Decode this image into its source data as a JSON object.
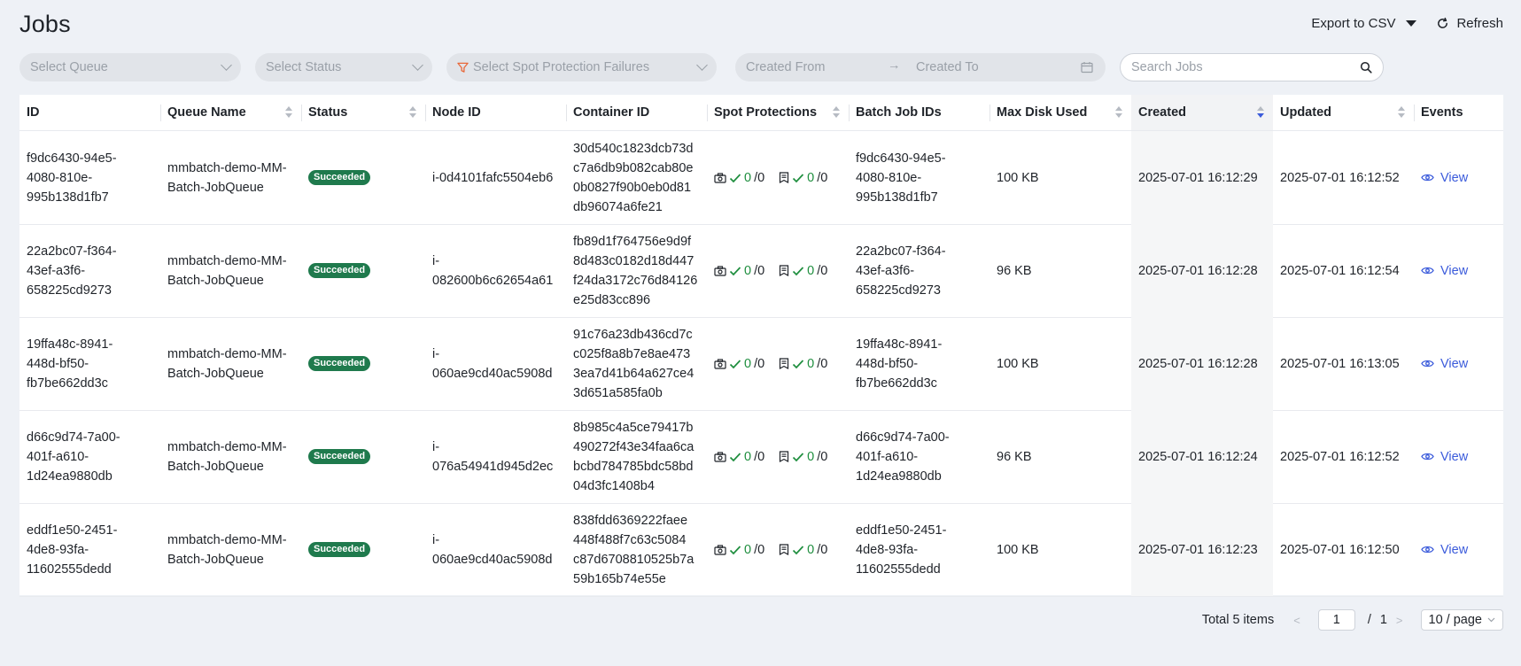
{
  "header": {
    "title": "Jobs",
    "export_label": "Export to CSV",
    "refresh_label": "Refresh"
  },
  "filters": {
    "queue_placeholder": "Select Queue",
    "status_placeholder": "Select Status",
    "spot_placeholder": "Select Spot Protection Failures",
    "created_from_placeholder": "Created From",
    "created_to_placeholder": "Created To",
    "search_placeholder": "Search Jobs"
  },
  "columns": [
    "ID",
    "Queue Name",
    "Status",
    "Node ID",
    "Container ID",
    "Spot Protections",
    "Batch Job IDs",
    "Max Disk Used",
    "Created",
    "Updated",
    "Events"
  ],
  "rows": [
    {
      "id": "f9dc6430-94e5-\n4080-810e-\n995b138d1fb7",
      "queue": "mmbatch-demo-MM-\nBatch-JobQueue",
      "status": "Succeeded",
      "node": "i-0d4101fafc5504eb6",
      "container": "30d540c1823dcb73d\nc7a6db9b082cab80e\n0b0827f90b0eb0d81\ndb96074a6fe21",
      "spot_a_ok": "0",
      "spot_a_total": "/0",
      "spot_b_ok": "0",
      "spot_b_total": "/0",
      "batch": "f9dc6430-94e5-\n4080-810e-\n995b138d1fb7",
      "disk": "100 KB",
      "created": "2025-07-01 16:12:29",
      "updated": "2025-07-01 16:12:52",
      "events": "View"
    },
    {
      "id": "22a2bc07-f364-\n43ef-a3f6-\n658225cd9273",
      "queue": "mmbatch-demo-MM-\nBatch-JobQueue",
      "status": "Succeeded",
      "node": "i-\n082600b6c62654a61",
      "container": "fb89d1f764756e9d9f\n8d483c0182d18d447\nf24da3172c76d84126\ne25d83cc896",
      "spot_a_ok": "0",
      "spot_a_total": "/0",
      "spot_b_ok": "0",
      "spot_b_total": "/0",
      "batch": "22a2bc07-f364-\n43ef-a3f6-\n658225cd9273",
      "disk": "96 KB",
      "created": "2025-07-01 16:12:28",
      "updated": "2025-07-01 16:12:54",
      "events": "View"
    },
    {
      "id": "19ffa48c-8941-\n448d-bf50-\nfb7be662dd3c",
      "queue": "mmbatch-demo-MM-\nBatch-JobQueue",
      "status": "Succeeded",
      "node": "i-\n060ae9cd40ac5908d",
      "container": "91c76a23db436cd7c\nc025f8a8b7e8ae473\n3ea7d41b64a627ce4\n3d651a585fa0b",
      "spot_a_ok": "0",
      "spot_a_total": "/0",
      "spot_b_ok": "0",
      "spot_b_total": "/0",
      "batch": "19ffa48c-8941-\n448d-bf50-\nfb7be662dd3c",
      "disk": "100 KB",
      "created": "2025-07-01 16:12:28",
      "updated": "2025-07-01 16:13:05",
      "events": "View"
    },
    {
      "id": "d66c9d74-7a00-\n401f-a610-\n1d24ea9880db",
      "queue": "mmbatch-demo-MM-\nBatch-JobQueue",
      "status": "Succeeded",
      "node": "i-\n076a54941d945d2ec",
      "container": "8b985c4a5ce79417b\n490272f43e34faa6ca\nbcbd784785bdc58bd\n04d3fc1408b4",
      "spot_a_ok": "0",
      "spot_a_total": "/0",
      "spot_b_ok": "0",
      "spot_b_total": "/0",
      "batch": "d66c9d74-7a00-\n401f-a610-\n1d24ea9880db",
      "disk": "96 KB",
      "created": "2025-07-01 16:12:24",
      "updated": "2025-07-01 16:12:52",
      "events": "View"
    },
    {
      "id": "eddf1e50-2451-\n4de8-93fa-\n11602555dedd",
      "queue": "mmbatch-demo-MM-\nBatch-JobQueue",
      "status": "Succeeded",
      "node": "i-\n060ae9cd40ac5908d",
      "container": "838fdd6369222faee\n448f488f7c63c5084\nc87d6708810525b7a\n59b165b74e55e",
      "spot_a_ok": "0",
      "spot_a_total": "/0",
      "spot_b_ok": "0",
      "spot_b_total": "/0",
      "batch": "eddf1e50-2451-\n4de8-93fa-\n11602555dedd",
      "disk": "100 KB",
      "created": "2025-07-01 16:12:23",
      "updated": "2025-07-01 16:12:50",
      "events": "View"
    }
  ],
  "pagination": {
    "total": "Total 5 items",
    "current_page": "1",
    "separator": "/",
    "total_pages": "1",
    "page_size": "10 / page"
  },
  "colors": {
    "accent": "#3b5bdb",
    "success_badge": "#1f7a4d",
    "check": "#1e8e3e",
    "page_bg": "#eef1f6"
  }
}
